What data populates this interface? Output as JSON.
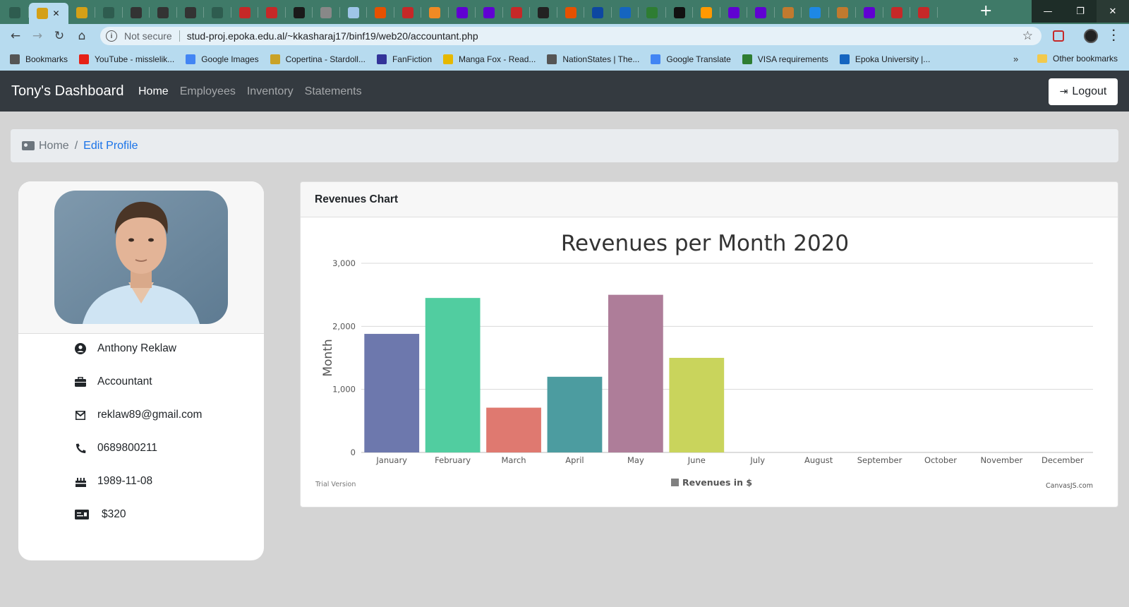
{
  "browser": {
    "address": {
      "security_label": "Not secure",
      "url": "stud-proj.epoka.edu.al/~kkasharaj17/binf19/web20/accountant.php"
    },
    "bookmarks": [
      {
        "label": "Bookmarks",
        "icon": "star-icon",
        "color": "#555555"
      },
      {
        "label": "YouTube - misslelik...",
        "icon": "youtube-icon",
        "color": "#e62117"
      },
      {
        "label": "Google Images",
        "icon": "google-icon",
        "color": "#4285f4"
      },
      {
        "label": "Copertina - Stardoll...",
        "icon": "stardoll-icon",
        "color": "#c9a227"
      },
      {
        "label": "FanFiction",
        "icon": "fanfiction-icon",
        "color": "#333399"
      },
      {
        "label": "Manga Fox - Read...",
        "icon": "mangafox-icon",
        "color": "#e6b800"
      },
      {
        "label": "NationStates | The...",
        "icon": "nationstates-icon",
        "color": "#555555"
      },
      {
        "label": "Google Translate",
        "icon": "translate-icon",
        "color": "#4285f4"
      },
      {
        "label": "VISA requirements",
        "icon": "visa-icon",
        "color": "#2e7d32"
      },
      {
        "label": "Epoka University |...",
        "icon": "epoka-icon",
        "color": "#1565c0"
      }
    ],
    "bookmarks_more": "»",
    "other_bookmarks": "Other bookmarks"
  },
  "app": {
    "brand": "Tony's Dashboard",
    "nav": [
      "Home",
      "Employees",
      "Inventory",
      "Statements"
    ],
    "logout_label": "Logout"
  },
  "breadcrumb": {
    "home": "Home",
    "separator": "/",
    "current": "Edit Profile"
  },
  "profile": {
    "name": "Anthony Reklaw",
    "role": "Accountant",
    "email": "reklaw89@gmail.com",
    "phone": "0689800211",
    "birthday": "1989-11-08",
    "salary": "$320"
  },
  "chart_card": {
    "header": "Revenues Chart"
  },
  "chart_data": {
    "type": "bar",
    "title": "Revenues per Month 2020",
    "ylabel": "Month",
    "xlabel": "",
    "categories": [
      "January",
      "February",
      "March",
      "April",
      "May",
      "June",
      "July",
      "August",
      "September",
      "October",
      "November",
      "December"
    ],
    "series": [
      {
        "name": "Revenues in $",
        "values": [
          1880,
          2450,
          710,
          1200,
          2500,
          1500,
          null,
          null,
          null,
          null,
          null,
          null
        ]
      }
    ],
    "bar_colors": [
      "#6d78ad",
      "#51cda0",
      "#df7970",
      "#4c9ca0",
      "#ae7d99",
      "#c9d45c"
    ],
    "ylim": [
      0,
      3000
    ],
    "yticks": [
      "0",
      "1,000",
      "2,000",
      "3,000"
    ],
    "ytick_values": [
      0,
      1000,
      2000,
      3000
    ],
    "grid": true,
    "legend_position": "bottom",
    "watermark_left": "Trial Version",
    "watermark_right": "CanvasJS.com"
  }
}
